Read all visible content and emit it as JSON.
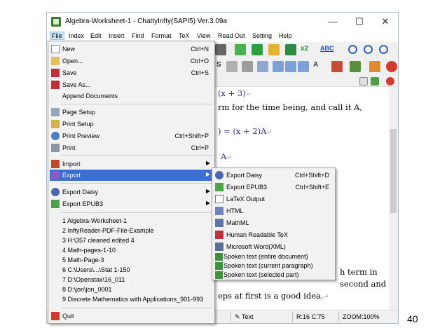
{
  "window": {
    "title": "Algebra-Worksheet-1 - ChattyInfty(SAPI5) Ver.3.09a",
    "minimize": "—",
    "maximize": "☐",
    "close": "✕"
  },
  "menubar": [
    "File",
    "Index",
    "Edit",
    "Insert",
    "Find",
    "Format",
    "TeX",
    "View",
    "Read Out",
    "Setting",
    "Help"
  ],
  "toolbar": {
    "abc_label": "ABC",
    "s_label": "S",
    "a_label": "A",
    "x2_label": "x2"
  },
  "document": {
    "lines": [
      {
        "math": "(x + 3)",
        "text": ""
      },
      {
        "math": "",
        "text": "rm for the time being, and call it A,"
      },
      {
        "math": ") = (x + 2)A",
        "text": ""
      },
      {
        "math": "A",
        "text": ""
      },
      {
        "math": "",
        "text": "h term in"
      },
      {
        "math": "",
        "text": "second and leave out the middle"
      },
      {
        "math": "",
        "text": "eps at first is a good idea."
      }
    ],
    "return_mark": "↵"
  },
  "statusbar": {
    "mode": "Text",
    "position": "R:16 C:75",
    "zoom": "ZOOM:100%"
  },
  "file_menu": {
    "items": [
      {
        "label": "New",
        "shortcut": "Ctrl+N",
        "icon": "new-file-icon"
      },
      {
        "label": "Open...",
        "shortcut": "Ctrl+O",
        "icon": "open-folder-icon"
      },
      {
        "label": "Save",
        "shortcut": "Ctrl+S",
        "icon": "save-icon"
      },
      {
        "label": "Save As...",
        "shortcut": "",
        "icon": "save-as-icon"
      },
      {
        "label": "Append Documents",
        "shortcut": "",
        "icon": ""
      },
      {
        "label": "Page Setup",
        "shortcut": "",
        "icon": "page-setup-icon"
      },
      {
        "label": "Print Setup",
        "shortcut": "",
        "icon": "print-setup-icon"
      },
      {
        "label": "Print Preview",
        "shortcut": "Ctrl+Shift+P",
        "icon": "print-preview-icon"
      },
      {
        "label": "Print",
        "shortcut": "Ctrl+P",
        "icon": "print-icon"
      },
      {
        "label": "Import",
        "shortcut": "",
        "icon": "import-icon",
        "submenu": true
      },
      {
        "label": "Export",
        "shortcut": "",
        "icon": "export-icon",
        "submenu": true
      },
      {
        "label": "Export Daisy",
        "shortcut": "",
        "icon": "daisy-icon",
        "submenu": true
      },
      {
        "label": "Export EPUB3",
        "shortcut": "",
        "icon": "epub-icon",
        "submenu": true
      }
    ],
    "recent": [
      "1 Algebra-Worksheet-1",
      "2 InftyReader-PDF-File-Example",
      "3 H:\\357 cleaned edited 4",
      "4 Math-pages-1-10",
      "5 Math-Page-3",
      "6 C:\\Users\\...\\Stat 1-150",
      "7 D:\\Openstax\\16_011",
      "8 D:\\jon\\jon_0001",
      "9 Discrete Mathematics with Applications_901-993"
    ],
    "quit": "Quit"
  },
  "export_menu": {
    "items": [
      {
        "label": "Export Daisy",
        "shortcut": "Ctrl+Shift+D",
        "icon": "daisy-icon"
      },
      {
        "label": "Export EPUB3",
        "shortcut": "Ctrl+Shift+E",
        "icon": "epub-icon"
      },
      {
        "label": "LaTeX Output",
        "shortcut": "",
        "icon": "latex-icon"
      },
      {
        "label": "HTML",
        "shortcut": "",
        "icon": "html-icon"
      },
      {
        "label": "MathML",
        "shortcut": "",
        "icon": "mathml-icon"
      },
      {
        "label": "Human Readable TeX",
        "shortcut": "",
        "icon": "tex-icon"
      },
      {
        "label": "Microsoft Word(XML)",
        "shortcut": "",
        "icon": "word-icon"
      },
      {
        "label": "Spoken text (entire document)",
        "shortcut": "",
        "icon": "speech-icon"
      },
      {
        "label": "Spoken text (current paragraph)",
        "shortcut": "",
        "icon": "speech-icon"
      },
      {
        "label": "Spoken text (selected part)",
        "shortcut": "",
        "icon": "speech-icon"
      }
    ]
  },
  "page_number": "40"
}
